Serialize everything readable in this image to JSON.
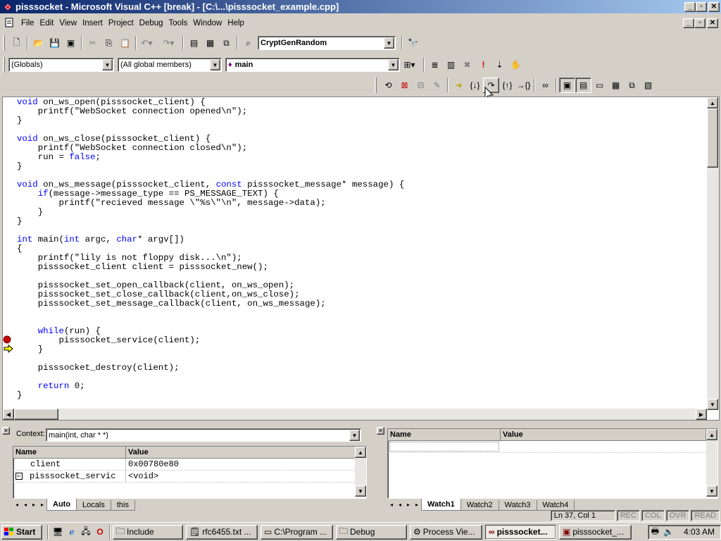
{
  "window": {
    "title": "pisssocket - Microsoft Visual C++ [break] - [C:\\...\\pisssocket_example.cpp]"
  },
  "menu": [
    "File",
    "Edit",
    "View",
    "Insert",
    "Project",
    "Debug",
    "Tools",
    "Window",
    "Help"
  ],
  "toolbar": {
    "find_combo": "CryptGenRandom"
  },
  "wizardbar": {
    "class_combo": "(Globals)",
    "members_combo": "(All global members)",
    "function_combo": "main"
  },
  "editor": {
    "lines": [
      "void on_ws_open(pisssocket_client) {",
      "    printf(\"WebSocket connection opened\\n\");",
      "}",
      "",
      "void on_ws_close(pisssocket_client) {",
      "    printf(\"WebSocket connection closed\\n\");",
      "    run = false;",
      "}",
      "",
      "void on_ws_message(pisssocket_client, const pisssocket_message* message) {",
      "    if(message->message_type == PS_MESSAGE_TEXT) {",
      "        printf(\"recieved message \\\"%s\\\"\\n\", message->data);",
      "    }",
      "}",
      "",
      "int main(int argc, char* argv[])",
      "{",
      "    printf(\"lily is not floppy disk...\\n\");",
      "    pisssocket_client client = pisssocket_new();",
      "",
      "    pisssocket_set_open_callback(client, on_ws_open);",
      "    pisssocket_set_close_callback(client,on_ws_close);",
      "    pisssocket_set_message_callback(client, on_ws_message);",
      "",
      "",
      "    while(run) {",
      "        pisssocket_service(client);",
      "    }",
      "",
      "    pisssocket_destroy(client);",
      "",
      "    return 0;",
      "}"
    ],
    "breakpoint_line": 26,
    "current_line": 28
  },
  "variables": {
    "context_label": "Context:",
    "context_value": "main(int, char * *)",
    "headers": [
      "Name",
      "Value"
    ],
    "rows": [
      {
        "name": "client",
        "value": "0x00780e80"
      },
      {
        "name": "pisssocket_servic",
        "value": "<void>"
      }
    ],
    "tabs": [
      "Auto",
      "Locals",
      "this"
    ]
  },
  "watch": {
    "headers": [
      "Name",
      "Value"
    ],
    "tabs": [
      "Watch1",
      "Watch2",
      "Watch3",
      "Watch4"
    ]
  },
  "status": {
    "position": "Ln 37, Col 1",
    "indicators": [
      "REC",
      "COL",
      "OVR",
      "READ"
    ]
  },
  "taskbar": {
    "start": "Start",
    "tasks": [
      "Include",
      "rfc6455.txt ...",
      "C:\\Program ...",
      "Debug",
      "Process Vie...",
      "pisssocket...",
      "pisssocket_..."
    ],
    "clock": "4:03 AM"
  },
  "colors": {
    "title_start": "#0a246a",
    "title_end": "#a6caf0",
    "keyword": "#0000ff",
    "breakpoint": "#c00000",
    "arrow": "#ffff00"
  }
}
